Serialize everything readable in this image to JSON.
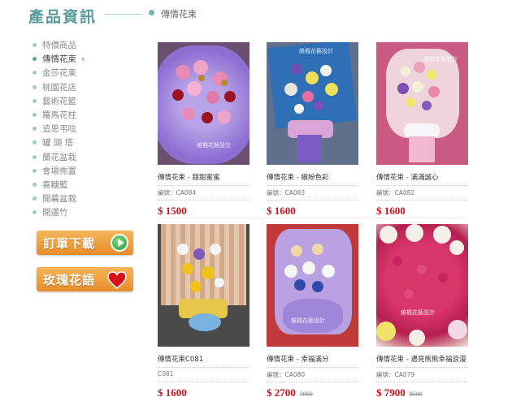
{
  "header": {
    "title": "產品資訊",
    "breadcrumb": "傳情花束"
  },
  "sidebar": {
    "items": [
      {
        "label": "特價商品",
        "active": false
      },
      {
        "label": "傳情花束",
        "active": true
      },
      {
        "label": "金莎花束",
        "active": false
      },
      {
        "label": "桃園花店",
        "active": false
      },
      {
        "label": "藝術花籃",
        "active": false
      },
      {
        "label": "羅馬花柱",
        "active": false
      },
      {
        "label": "追思弔唁",
        "active": false
      },
      {
        "label": "罐 頭 塔",
        "active": false
      },
      {
        "label": "蘭花盆栽",
        "active": false
      },
      {
        "label": "會場佈置",
        "active": false
      },
      {
        "label": "喜糖籃",
        "active": false
      },
      {
        "label": "開幕盆栽",
        "active": false
      },
      {
        "label": "開運竹",
        "active": false
      }
    ]
  },
  "buttons": {
    "order": "訂單下載",
    "rose": "玫瑰花語"
  },
  "products": [
    {
      "name": "傳情花束 - 甜甜蜜蜜",
      "code": "編號：CA084",
      "price": "$ 1500",
      "old_price": "",
      "watermark": "維楓花藝設計"
    },
    {
      "name": "傳情花束 - 繽紛色彩",
      "code": "編號：CA083",
      "price": "$ 1600",
      "old_price": "",
      "watermark": "維楓花藝設計"
    },
    {
      "name": "傳情花束 - 滿滿誠心",
      "code": "編號：CA082",
      "price": "$ 1600",
      "old_price": "",
      "watermark": "維楓花藝設計"
    },
    {
      "name": "傳情花束C081",
      "code": "C081",
      "price": "$ 1600",
      "old_price": "",
      "watermark": ""
    },
    {
      "name": "傳情花束 - 幸福滿分",
      "code": "編號：CA080",
      "price": "$ 2700",
      "old_price": "3000",
      "watermark": "維楓花藝設計"
    },
    {
      "name": "傳情花束 - 遇見熊熊幸福浪漫",
      "code": "編號：CA079",
      "price": "$ 7900",
      "old_price": "8500",
      "watermark": "維楓花藝設計"
    }
  ],
  "colors": {
    "title": "#5a9a9a",
    "price": "#c8141e",
    "button": "#e88d2a",
    "active_arrow": "#e07b2f"
  }
}
